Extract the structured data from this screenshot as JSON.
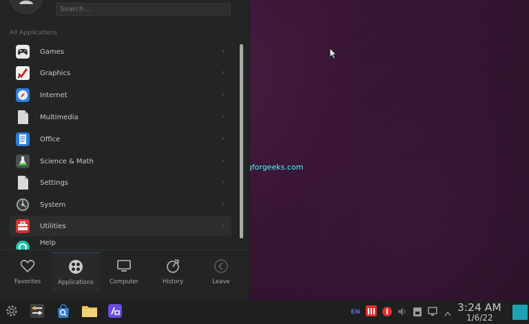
{
  "launcher": {
    "search_placeholder": "Search...",
    "section_label": "All Applications",
    "apps": [
      {
        "label": "Games",
        "icon": "gamepad-icon"
      },
      {
        "label": "Graphics",
        "icon": "graphics-icon"
      },
      {
        "label": "Internet",
        "icon": "compass-icon"
      },
      {
        "label": "Multimedia",
        "icon": "file-icon"
      },
      {
        "label": "Office",
        "icon": "document-icon"
      },
      {
        "label": "Science & Math",
        "icon": "flask-icon"
      },
      {
        "label": "Settings",
        "icon": "file-icon"
      },
      {
        "label": "System",
        "icon": "system-icon"
      },
      {
        "label": "Utilities",
        "icon": "toolbox-icon"
      },
      {
        "label": "Help",
        "icon": "help-icon"
      }
    ],
    "tabs": [
      {
        "label": "Favorites",
        "icon": "heart-icon"
      },
      {
        "label": "Applications",
        "icon": "grid-icon"
      },
      {
        "label": "Computer",
        "icon": "monitor-icon"
      },
      {
        "label": "History",
        "icon": "history-icon"
      },
      {
        "label": "Leave",
        "icon": "leave-icon"
      }
    ]
  },
  "desktop": {
    "watermark": "computingforgeeks.com"
  },
  "taskbar": {
    "language": "EN",
    "time": "3:24 AM",
    "date": "1/6/22"
  },
  "colors": {
    "accent": "#5a63c8",
    "panel": "#222523",
    "show_desktop": "#1ba3b3"
  }
}
